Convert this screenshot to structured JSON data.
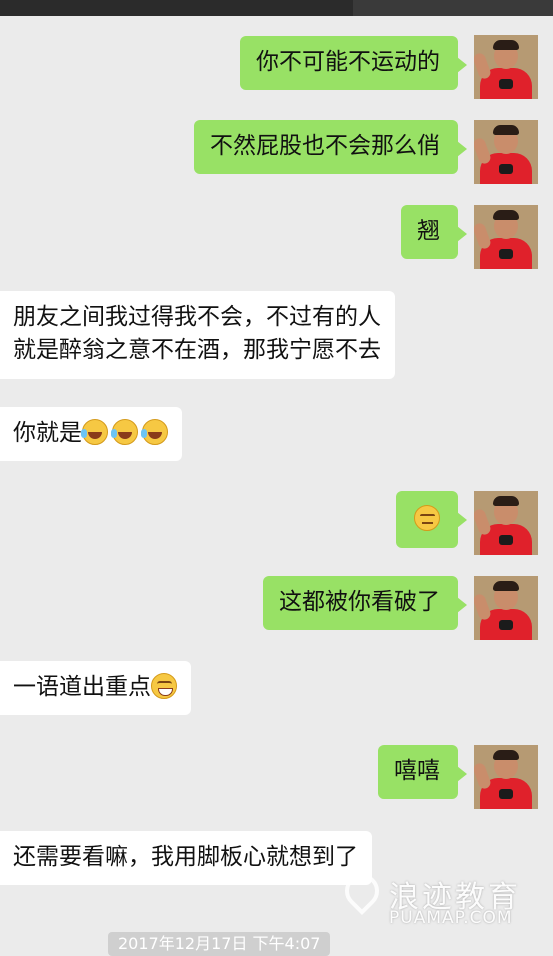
{
  "messages": [
    {
      "side": "out",
      "text": "你不可能不运动的"
    },
    {
      "side": "out",
      "text": "不然屁股也不会那么俏"
    },
    {
      "side": "out",
      "text": "翘"
    },
    {
      "side": "in",
      "line1": "朋友之间我过得我不会，不过有的人",
      "line2": "就是醉翁之意不在酒，那我宁愿不去"
    },
    {
      "side": "in",
      "text": "你就是",
      "emoji": [
        "laughing-crying",
        "laughing-crying",
        "laughing-crying"
      ]
    },
    {
      "side": "out",
      "emoji": "unamused"
    },
    {
      "side": "out",
      "text": "这都被你看破了"
    },
    {
      "side": "in",
      "text": "一语道出重点",
      "emoji": "grinning-smile"
    },
    {
      "side": "out",
      "text": "嘻嘻"
    },
    {
      "side": "in",
      "text": "还需要看嘛，我用脚板心就想到了"
    }
  ],
  "watermark": {
    "cn": "浪迹教育",
    "en": "PUAMAP.COM"
  },
  "timestamp": "2017年12月17日 下午4:07",
  "colors": {
    "outgoing": "#98e165",
    "incoming": "#ffffff",
    "background": "#ebebeb"
  }
}
